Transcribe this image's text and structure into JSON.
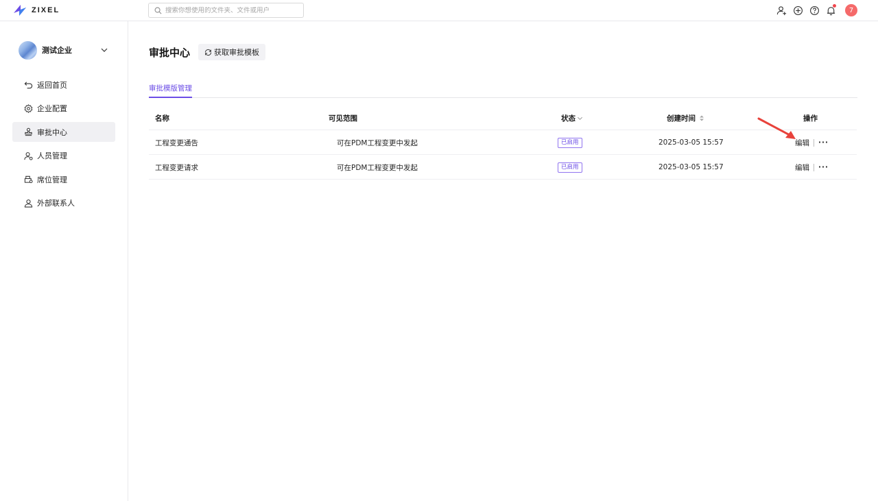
{
  "app": {
    "logo_text": "ZIXEL",
    "brand_color": "#6b4de6"
  },
  "search": {
    "placeholder": "搜索你想使用的文件夹、文件或用户"
  },
  "topbar": {
    "icons": [
      "add-user-icon",
      "plus-circle-icon",
      "help-icon",
      "bell-icon"
    ],
    "user_badge": "7"
  },
  "sidebar": {
    "org_name": "测试企业",
    "items": [
      {
        "label": "返回首页",
        "icon": "back-icon",
        "active": false
      },
      {
        "label": "企业配置",
        "icon": "gear-icon",
        "active": false
      },
      {
        "label": "审批中心",
        "icon": "stamp-icon",
        "active": true
      },
      {
        "label": "人员管理",
        "icon": "users-icon",
        "active": false
      },
      {
        "label": "席位管理",
        "icon": "seat-icon",
        "active": false
      },
      {
        "label": "外部联系人",
        "icon": "contacts-icon",
        "active": false
      }
    ]
  },
  "main": {
    "title": "审批中心",
    "fetch_button": "获取审批模板",
    "tabs": [
      {
        "label": "审批模版管理",
        "active": true
      }
    ]
  },
  "table": {
    "columns": {
      "name": "名称",
      "scope": "可见范围",
      "status": "状态",
      "time": "创建时间",
      "op": "操作"
    },
    "rows": [
      {
        "name": "工程变更通告",
        "scope": "可在PDM工程变更中发起",
        "status": "已启用",
        "time": "2025-03-05 15:57",
        "edit": "编辑",
        "more": "···"
      },
      {
        "name": "工程变更请求",
        "scope": "可在PDM工程变更中发起",
        "status": "已启用",
        "time": "2025-03-05 15:57",
        "edit": "编辑",
        "more": "···"
      }
    ]
  }
}
